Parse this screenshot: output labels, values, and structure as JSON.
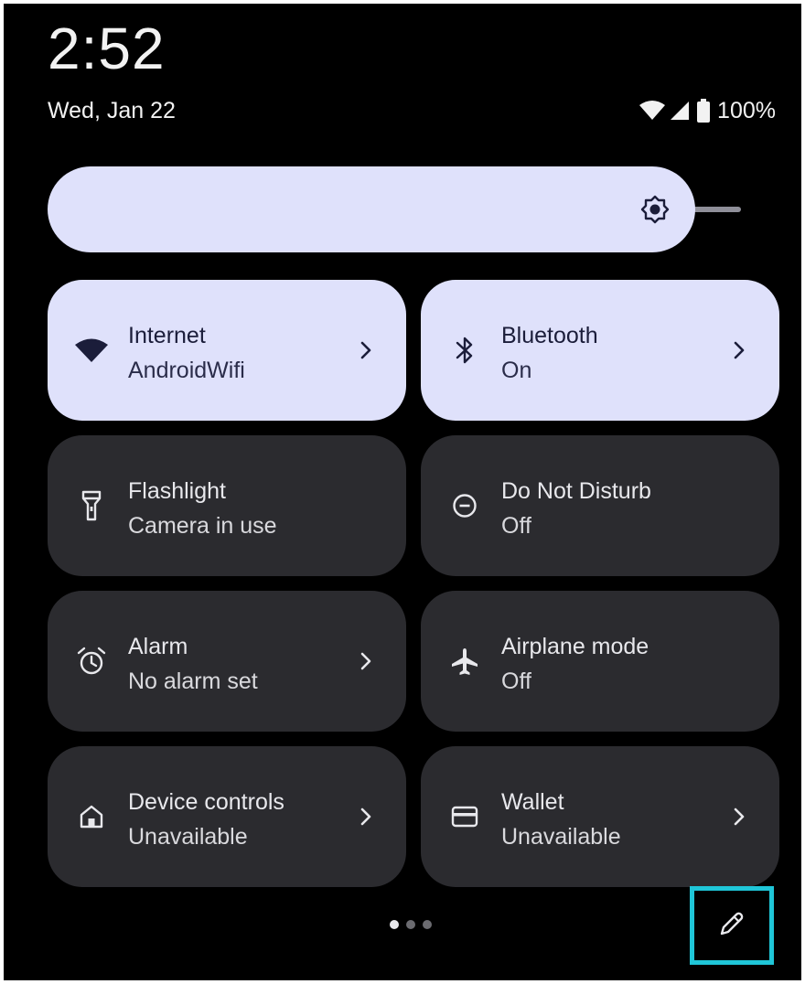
{
  "status_bar": {
    "time": "2:52",
    "date": "Wed, Jan 22",
    "battery": "100%",
    "icons": [
      "wifi-icon",
      "cellular-signal-icon",
      "battery-icon"
    ]
  },
  "brightness": {
    "icon": "brightness-icon"
  },
  "tiles": [
    {
      "title": "Internet",
      "subtitle": "AndroidWifi",
      "icon": "wifi-icon",
      "active": true,
      "chevron": true
    },
    {
      "title": "Bluetooth",
      "subtitle": "On",
      "icon": "bluetooth-icon",
      "active": true,
      "chevron": true
    },
    {
      "title": "Flashlight",
      "subtitle": "Camera in use",
      "icon": "flashlight-icon",
      "active": false,
      "chevron": false
    },
    {
      "title": "Do Not Disturb",
      "subtitle": "Off",
      "icon": "do-not-disturb-icon",
      "active": false,
      "chevron": false
    },
    {
      "title": "Alarm",
      "subtitle": "No alarm set",
      "icon": "alarm-icon",
      "active": false,
      "chevron": true
    },
    {
      "title": "Airplane mode",
      "subtitle": "Off",
      "icon": "airplane-icon",
      "active": false,
      "chevron": false
    },
    {
      "title": "Device controls",
      "subtitle": "Unavailable",
      "icon": "home-icon",
      "active": false,
      "chevron": true
    },
    {
      "title": "Wallet",
      "subtitle": "Unavailable",
      "icon": "wallet-icon",
      "active": false,
      "chevron": true
    }
  ],
  "pager": {
    "pages": 3,
    "current": 1
  },
  "edit": {
    "icon": "pencil-icon"
  },
  "colors": {
    "active_tile": "#dfe1fb",
    "inactive_tile": "#2b2b2f",
    "highlight": "#1fc6d8"
  }
}
